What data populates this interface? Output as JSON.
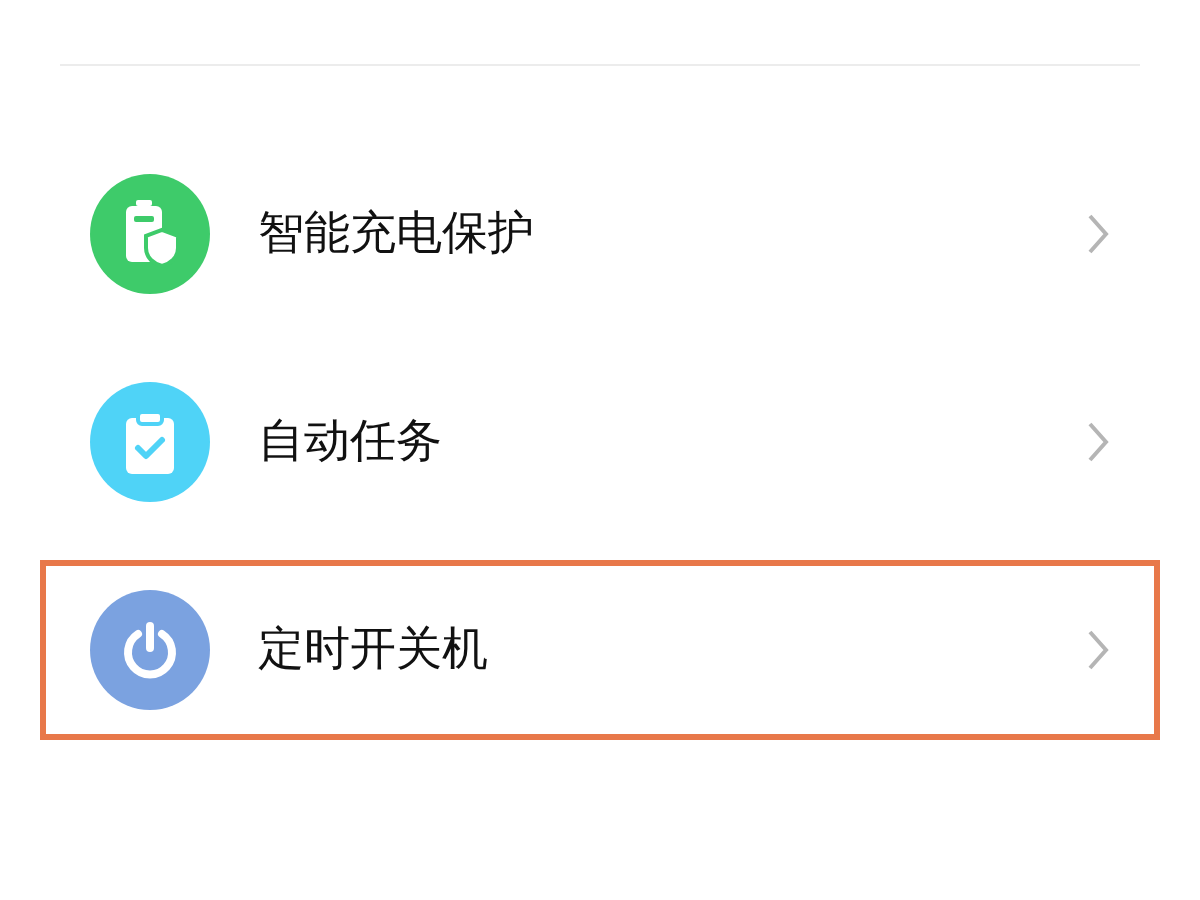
{
  "items": [
    {
      "kind": "battery-shield",
      "color": "#3ecb6a",
      "label": "智能充电保护",
      "highlighted": false
    },
    {
      "kind": "clipboard-check",
      "color": "#4fd3f7",
      "label": "自动任务",
      "highlighted": false
    },
    {
      "kind": "power",
      "color": "#7ba2e0",
      "label": "定时开关机",
      "highlighted": true
    }
  ]
}
